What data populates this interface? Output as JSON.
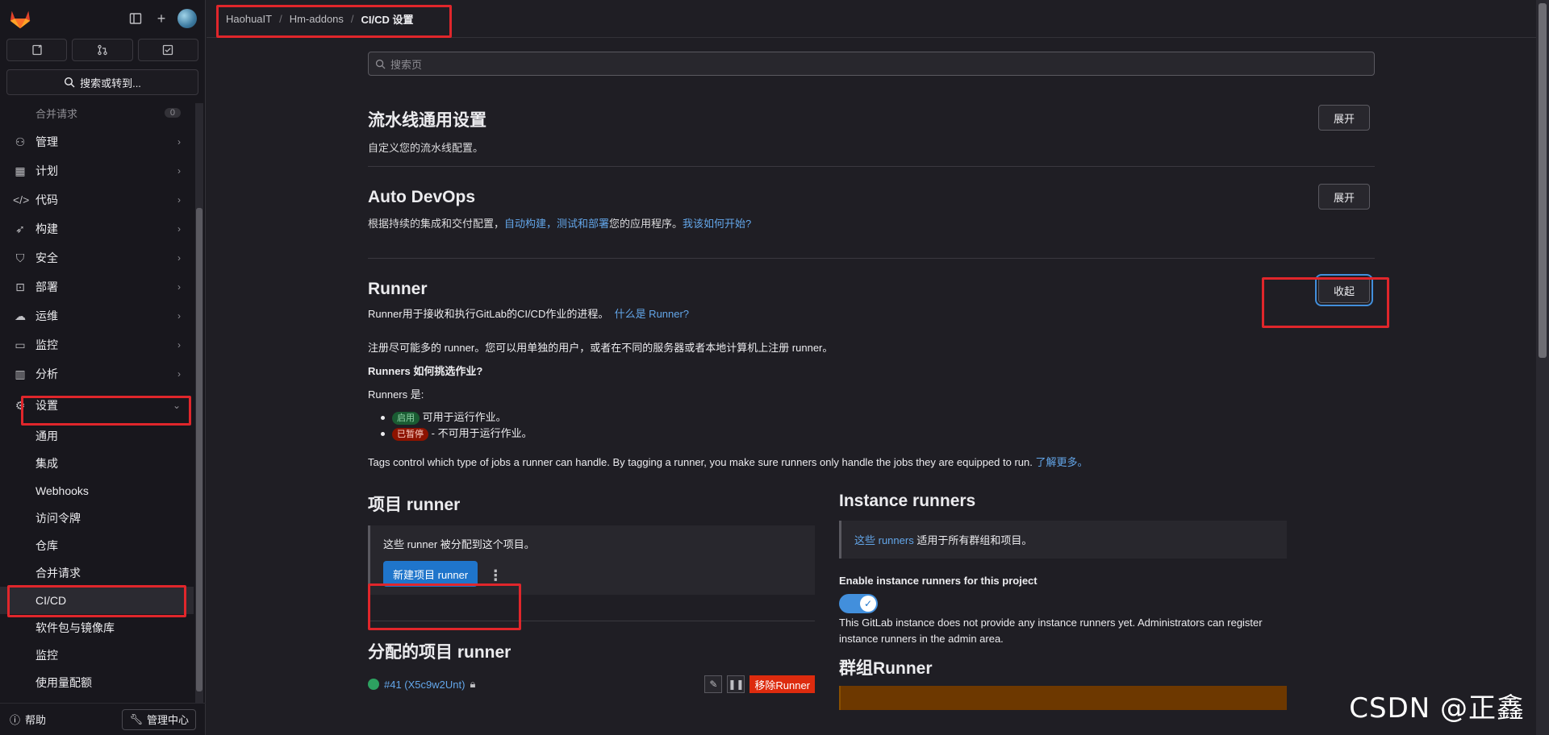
{
  "sidebar": {
    "search_label": "搜索或转到...",
    "faded_item": {
      "label": "合并请求",
      "count": "0"
    },
    "nav": [
      {
        "label": "管理",
        "icon": "users-icon"
      },
      {
        "label": "计划",
        "icon": "calendar-icon"
      },
      {
        "label": "代码",
        "icon": "code-icon"
      },
      {
        "label": "构建",
        "icon": "rocket-icon"
      },
      {
        "label": "安全",
        "icon": "shield-icon"
      },
      {
        "label": "部署",
        "icon": "deploy-icon"
      },
      {
        "label": "运维",
        "icon": "cloud-icon"
      },
      {
        "label": "监控",
        "icon": "monitor-icon"
      },
      {
        "label": "分析",
        "icon": "chart-icon"
      }
    ],
    "settings_label": "设置",
    "settings_sub": [
      "通用",
      "集成",
      "Webhooks",
      "访问令牌",
      "仓库",
      "合并请求",
      "CI/CD",
      "软件包与镜像库",
      "监控",
      "使用量配额"
    ],
    "help_label": "帮助",
    "admin_label": "管理中心"
  },
  "breadcrumb": {
    "group": "HaohuaIT",
    "project": "Hm-addons",
    "page": "CI/CD 设置"
  },
  "main": {
    "search_placeholder": "搜索页",
    "pipeline": {
      "title": "流水线通用设置",
      "desc": "自定义您的流水线配置。",
      "btn": "展开"
    },
    "autodevops": {
      "title": "Auto DevOps",
      "desc_pre": "根据持续的集成和交付配置，",
      "desc_link": "自动构建，测试和部署",
      "desc_mid": "您的应用程序。",
      "desc_link2": "我该如何开始?",
      "btn": "展开"
    },
    "runner": {
      "title": "Runner",
      "desc": "Runner用于接收和执行GitLab的CI/CD作业的进程。",
      "desc_link": "什么是 Runner?",
      "btn": "收起",
      "p1": "注册尽可能多的 runner。您可以用单独的用户，或者在不同的服务器或者本地计算机上注册 runner。",
      "q": "Runners 如何挑选作业?",
      "runners_are": "Runners 是:",
      "b1_badge": "启用",
      "b1_text": "可用于运行作业。",
      "b2_badge": "已暂停",
      "b2_text": "- 不可用于运行作业。",
      "tags": "Tags control which type of jobs a runner can handle. By tagging a runner, you make sure runners only handle the jobs they are equipped to run.",
      "tags_link": "了解更多。"
    },
    "project_runner": {
      "title": "项目 runner",
      "info": "这些 runner 被分配到这个项目。",
      "new_btn": "新建项目 runner",
      "assigned_title": "分配的项目 runner",
      "runner_id": "#41 (X5c9w2Unt)",
      "remove_btn": "移除Runner"
    },
    "instance_runners": {
      "title": "Instance runners",
      "info_link": "这些 runners",
      "info_text": "适用于所有群组和项目。",
      "enable_label": "Enable instance runners for this project",
      "note": "This GitLab instance does not provide any instance runners yet. Administrators can register instance runners in the admin area.",
      "group_title": "群组Runner"
    }
  },
  "watermark": "CSDN @正鑫",
  "colors": {
    "accent": "#1f75cb",
    "highlight": "#e0262b",
    "danger": "#dd2b0e"
  }
}
